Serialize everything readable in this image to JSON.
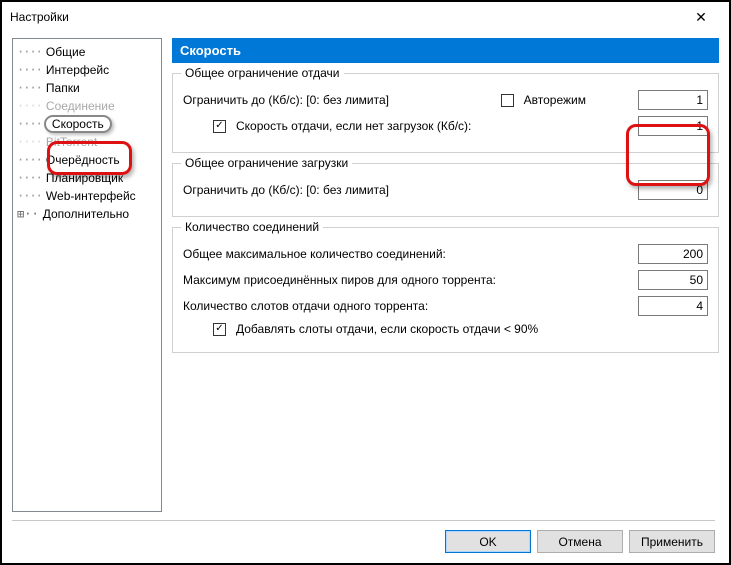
{
  "window": {
    "title": "Настройки"
  },
  "tree": {
    "items": [
      {
        "label": "Общие"
      },
      {
        "label": "Интерфейс"
      },
      {
        "label": "Папки"
      },
      {
        "label": "Соединение",
        "strike": true
      },
      {
        "label": "Скорость",
        "selected": true
      },
      {
        "label": "BitTorrent",
        "strike": true
      },
      {
        "label": "Очерёдность"
      },
      {
        "label": "Планировщик"
      },
      {
        "label": "Web-интерфейс"
      },
      {
        "label": "Дополнительно",
        "expand": true
      }
    ]
  },
  "page": {
    "title": "Скорость"
  },
  "upload": {
    "legend": "Общее ограничение отдачи",
    "limit_label": "Ограничить до (Кб/с): [0: без лимита]",
    "auto_label": "Авторежим",
    "auto_checked": false,
    "limit_value": "1",
    "alt_checked": true,
    "alt_label": "Скорость отдачи, если нет загрузок (Кб/с):",
    "alt_value": "1"
  },
  "download": {
    "legend": "Общее ограничение загрузки",
    "limit_label": "Ограничить до (Кб/с): [0: без лимита]",
    "limit_value": "0"
  },
  "conn": {
    "legend": "Количество соединений",
    "max_label": "Общее максимальное количество соединений:",
    "max_value": "200",
    "peers_label": "Максимум присоединённых пиров для одного торрента:",
    "peers_value": "50",
    "slots_label": "Количество слотов отдачи одного торрента:",
    "slots_value": "4",
    "addslots_checked": true,
    "addslots_label": "Добавлять слоты отдачи, если скорость отдачи < 90%"
  },
  "buttons": {
    "ok": "OK",
    "cancel": "Отмена",
    "apply": "Применить"
  }
}
